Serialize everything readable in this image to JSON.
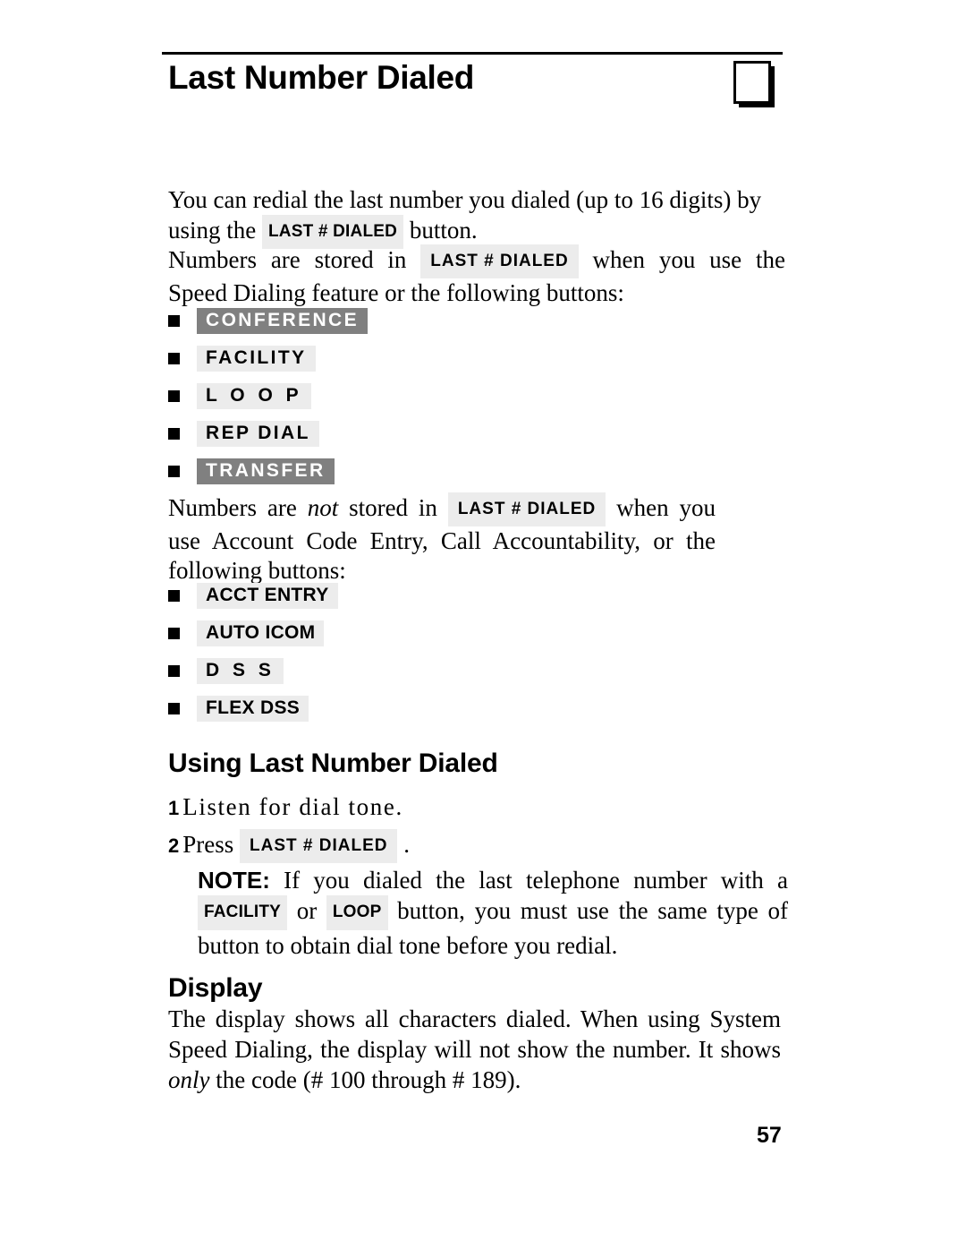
{
  "page": {
    "title": "Last Number Dialed",
    "folio": "57",
    "corner_mark_icon": "page-corner-square-icon"
  },
  "intro": {
    "p1_before": "You can redial the last number you dialed (up to 16 digits) by using the ",
    "p1_key": "LAST # DIALED",
    "p1_after": " button.",
    "p2_before": "Numbers are stored in ",
    "p2_key": "LAST # DIALED",
    "p2_after": " when you use the Speed Dialing feature or the following buttons:"
  },
  "stored_buttons": [
    {
      "label": "CONFERENCE",
      "style": "dark",
      "spacing": "ls1"
    },
    {
      "label": "FACILITY",
      "style": "light",
      "spacing": "ls1"
    },
    {
      "label": "L O O P",
      "style": "light",
      "spacing": "ls2"
    },
    {
      "label": "REP  DIAL",
      "style": "light",
      "spacing": "ls1"
    },
    {
      "label": "TRANSFER",
      "style": "dark",
      "spacing": "ls1"
    }
  ],
  "notstored": {
    "p_before": "Numbers are ",
    "p_italic": "not",
    "p_mid": " stored in ",
    "p_key": "LAST # DIALED",
    "p_after": " when you use Account Code Entry, Call Accountability, or the following buttons:"
  },
  "notstored_buttons": [
    {
      "label": "ACCT ENTRY",
      "style": "light",
      "spacing": "ls0"
    },
    {
      "label": "AUTO ICOM",
      "style": "light",
      "spacing": "ls0"
    },
    {
      "label": "D S S",
      "style": "light",
      "spacing": "ls2"
    },
    {
      "label": "FLEX  DSS",
      "style": "light",
      "spacing": "ls0"
    }
  ],
  "using": {
    "heading": "Using Last Number Dialed",
    "step1_num": "1",
    "step1_text": "Listen for dial tone.",
    "step2_num": "2",
    "step2_before": "Press ",
    "step2_key": "LAST # DIALED",
    "step2_after": " ."
  },
  "note": {
    "label": "NOTE:",
    "text_before": " If you dialed the last telephone number with a ",
    "key1": "FACILITY",
    "mid": " or ",
    "key2": "LOOP",
    "text_after": " button, you must use the same type of button to obtain dial tone before you redial."
  },
  "display": {
    "heading": "Display",
    "text_before": "The display shows all characters dialed. When using System Speed Dialing, the display will not show the number. It shows ",
    "italic": "only",
    "text_after": " the code (# 100 through # 189)."
  },
  "colors": {
    "key_light_bg": "#ececec",
    "key_dark_bg": "#808080",
    "ink": "#000000",
    "paper": "#ffffff"
  }
}
